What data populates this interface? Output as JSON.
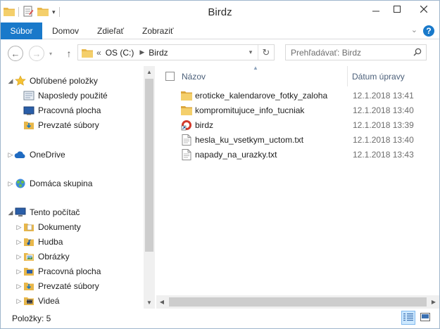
{
  "window": {
    "title": "Birdz"
  },
  "titlebar": {
    "qat_icons": [
      "folder-icon",
      "properties-icon",
      "new-folder-icon",
      "customize-qat-icon"
    ],
    "controls": [
      "minimize",
      "maximize",
      "close"
    ]
  },
  "ribbon": {
    "tabs": [
      {
        "label": "Súbor",
        "active": true
      },
      {
        "label": "Domov"
      },
      {
        "label": "Zdieľať"
      },
      {
        "label": "Zobraziť"
      }
    ],
    "help": "?"
  },
  "address": {
    "overflow": "«",
    "crumbs": [
      "OS (C:)",
      "Birdz"
    ]
  },
  "search": {
    "placeholder": "Prehľadávať: Birdz"
  },
  "navpane": {
    "items": [
      {
        "label": "Obľúbené položky",
        "icon": "star-icon",
        "expanded": true,
        "level": 0
      },
      {
        "label": "Naposledy použité",
        "icon": "recent-places-icon",
        "level": 1
      },
      {
        "label": "Pracovná plocha",
        "icon": "desktop-icon",
        "level": 1
      },
      {
        "label": "Prevzaté súbory",
        "icon": "downloads-icon",
        "level": 1
      },
      {
        "label": "OneDrive",
        "icon": "onedrive-icon",
        "expanded": false,
        "level": 0
      },
      {
        "label": "Domáca skupina",
        "icon": "homegroup-icon",
        "expanded": false,
        "level": 0
      },
      {
        "label": "Tento počítač",
        "icon": "computer-icon",
        "expanded": true,
        "level": 0
      },
      {
        "label": "Dokumenty",
        "icon": "documents-icon",
        "expanded": false,
        "level": 1
      },
      {
        "label": "Hudba",
        "icon": "music-icon",
        "expanded": false,
        "level": 1
      },
      {
        "label": "Obrázky",
        "icon": "pictures-icon",
        "expanded": false,
        "level": 1
      },
      {
        "label": "Pracovná plocha",
        "icon": "desktop-folder-icon",
        "expanded": false,
        "level": 1
      },
      {
        "label": "Prevzaté súbory",
        "icon": "downloads-icon",
        "expanded": false,
        "level": 1
      },
      {
        "label": "Videá",
        "icon": "videos-icon",
        "expanded": false,
        "level": 1
      }
    ]
  },
  "filelist": {
    "columns": {
      "name": "Názov",
      "date": "Dátum úpravy"
    },
    "sort": "name-ascending",
    "files": [
      {
        "name": "eroticke_kalendarove_fotky_zaloha",
        "date": "12.1.2018 13:41",
        "type": "folder"
      },
      {
        "name": "kompromitujuce_info_tucniak",
        "date": "12.1.2018 13:40",
        "type": "folder"
      },
      {
        "name": "birdz",
        "date": "12.1.2018 13:39",
        "type": "shortcut"
      },
      {
        "name": "hesla_ku_vsetkym_uctom.txt",
        "date": "12.1.2018 13:40",
        "type": "text"
      },
      {
        "name": "napady_na_urazky.txt",
        "date": "12.1.2018 13:43",
        "type": "text"
      }
    ]
  },
  "statusbar": {
    "count": "Položky: 5",
    "active_view": "details"
  },
  "colors": {
    "accent": "#1979ca",
    "folder": "#e8b74a",
    "header_text": "#4c607a",
    "selected_view_bg": "#cce8ff"
  }
}
